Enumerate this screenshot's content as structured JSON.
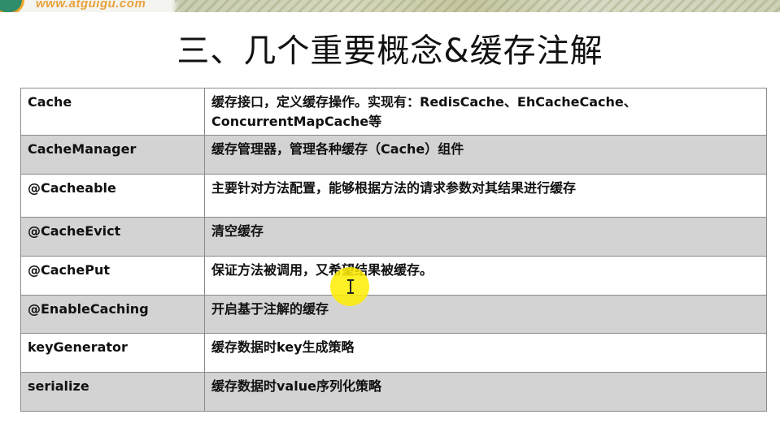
{
  "header": {
    "logo_text": "www.atguigu.com",
    "title": "三、几个重要概念&缓存注解"
  },
  "table": {
    "rows": [
      {
        "term": "Cache",
        "desc": "缓存接口，定义缓存操作。实现有：RedisCache、EhCacheCache、ConcurrentMapCache等"
      },
      {
        "term": "CacheManager",
        "desc": "缓存管理器，管理各种缓存（Cache）组件"
      },
      {
        "term": "@Cacheable",
        "desc": "主要针对方法配置，能够根据方法的请求参数对其结果进行缓存"
      },
      {
        "term": "@CacheEvict",
        "desc": "清空缓存"
      },
      {
        "term": "@CachePut",
        "desc": "保证方法被调用，又希望结果被缓存。"
      },
      {
        "term": "@EnableCaching",
        "desc": "开启基于注解的缓存"
      },
      {
        "term": "keyGenerator",
        "desc": "缓存数据时key生成策略"
      },
      {
        "term": "serialize",
        "desc": "缓存数据时value序列化策略"
      }
    ]
  },
  "colors": {
    "row_alt": "#d3d3d3",
    "cursor_highlight": "#ffec00",
    "logo_text": "#e8a23a"
  }
}
